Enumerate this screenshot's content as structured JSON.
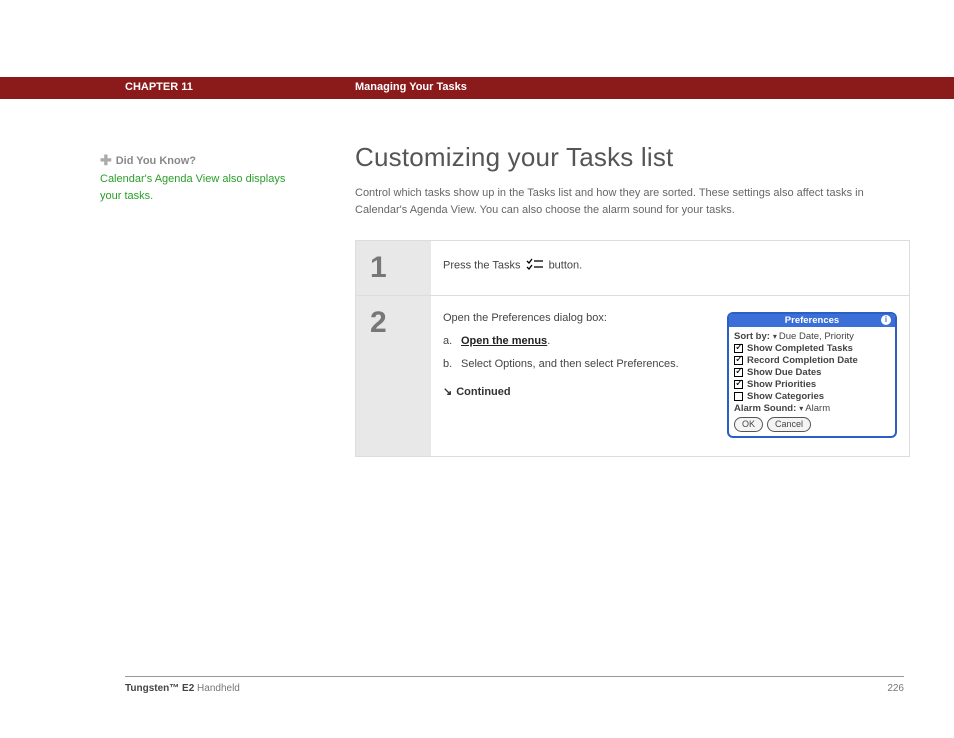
{
  "header": {
    "chapter": "CHAPTER 11",
    "section": "Managing Your Tasks"
  },
  "sidebar": {
    "heading": "Did You Know?",
    "text": "Calendar's Agenda View also displays your tasks."
  },
  "main": {
    "title": "Customizing your Tasks list",
    "intro": "Control which tasks show up in the Tasks list and how they are sorted. These settings also affect tasks in Calendar's Agenda View. You can also choose the alarm sound for your tasks."
  },
  "steps": [
    {
      "num": "1",
      "text_before": "Press the Tasks ",
      "text_after": " button."
    },
    {
      "num": "2",
      "intro": "Open the Preferences dialog box:",
      "items": [
        {
          "letter": "a.",
          "text": "Open the menus",
          "suffix": ".",
          "link": true
        },
        {
          "letter": "b.",
          "text": "Select Options, and then select Preferences.",
          "link": false
        }
      ],
      "continued": "Continued"
    }
  ],
  "dialog": {
    "title": "Preferences",
    "sort_label": "Sort by:",
    "sort_value": "Due Date, Priority",
    "options": [
      {
        "label": "Show Completed Tasks",
        "checked": true
      },
      {
        "label": "Record Completion Date",
        "checked": true
      },
      {
        "label": "Show Due Dates",
        "checked": true
      },
      {
        "label": "Show Priorities",
        "checked": true
      },
      {
        "label": "Show Categories",
        "checked": false
      }
    ],
    "alarm_label": "Alarm Sound:",
    "alarm_value": "Alarm",
    "ok": "OK",
    "cancel": "Cancel"
  },
  "footer": {
    "product_bold": "Tungsten™ E2",
    "product_rest": " Handheld",
    "page": "226"
  }
}
